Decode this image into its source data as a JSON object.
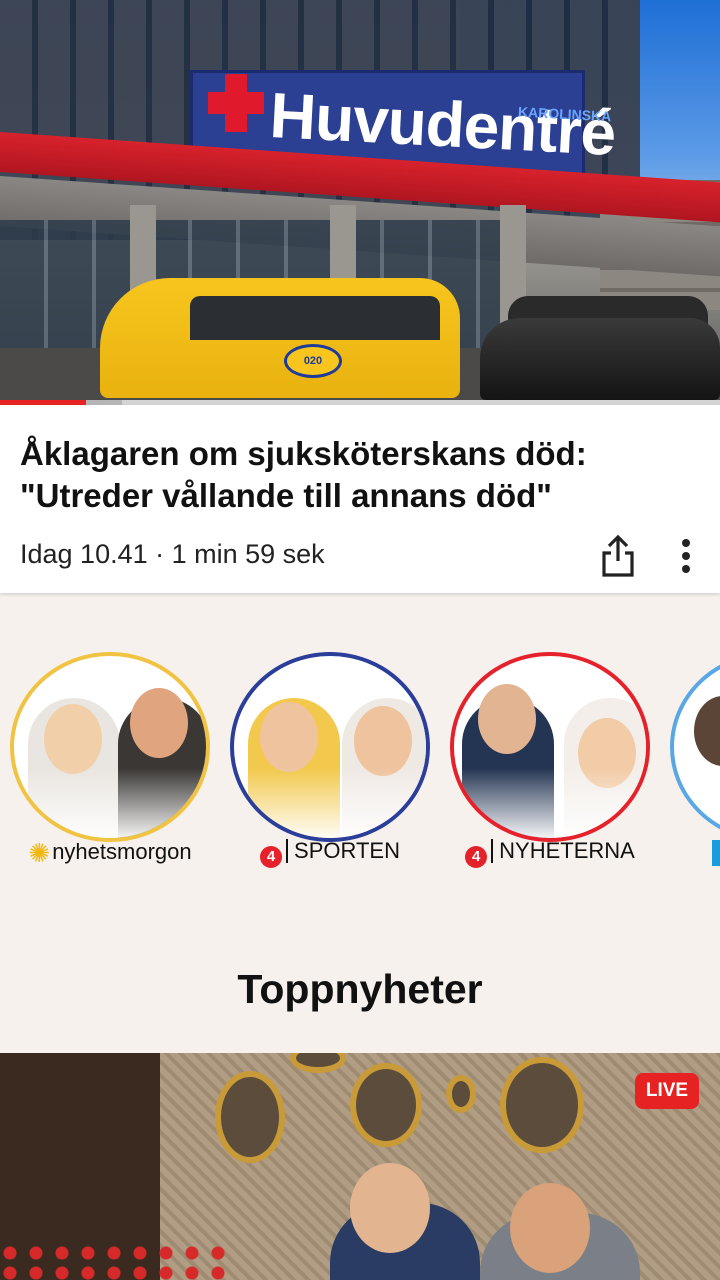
{
  "hero": {
    "sign_text": "Huvudentré",
    "sign_subtext": "KAROLINSKA",
    "van_logo": "020",
    "progress_percent": 12,
    "buffer_percent": 5
  },
  "article": {
    "headline": "Åklagaren om sjuksköterskans död:\n\"Utreder vållande till annans död\"",
    "meta": "Idag 10.41 · 1 min 59 sek",
    "share_icon": "share-icon",
    "more_icon": "more-vertical-icon"
  },
  "channels": [
    {
      "label": "nyhetsmorgon",
      "ring_color": "#f0c342",
      "icon": "sun-icon"
    },
    {
      "label": "SPORTEN",
      "ring_color": "#2a3e9a",
      "icon": "tv4-icon",
      "badge": "4"
    },
    {
      "label": "NYHETERNA",
      "ring_color": "#e5222b",
      "icon": "tv4-icon",
      "badge": "4"
    },
    {
      "label": "",
      "ring_color": "#5aa7e6"
    }
  ],
  "section": {
    "title": "Toppnyheter"
  },
  "bottom_video": {
    "badge": "LIVE"
  },
  "colors": {
    "accent": "#e62222",
    "background": "#f6f1ec"
  }
}
